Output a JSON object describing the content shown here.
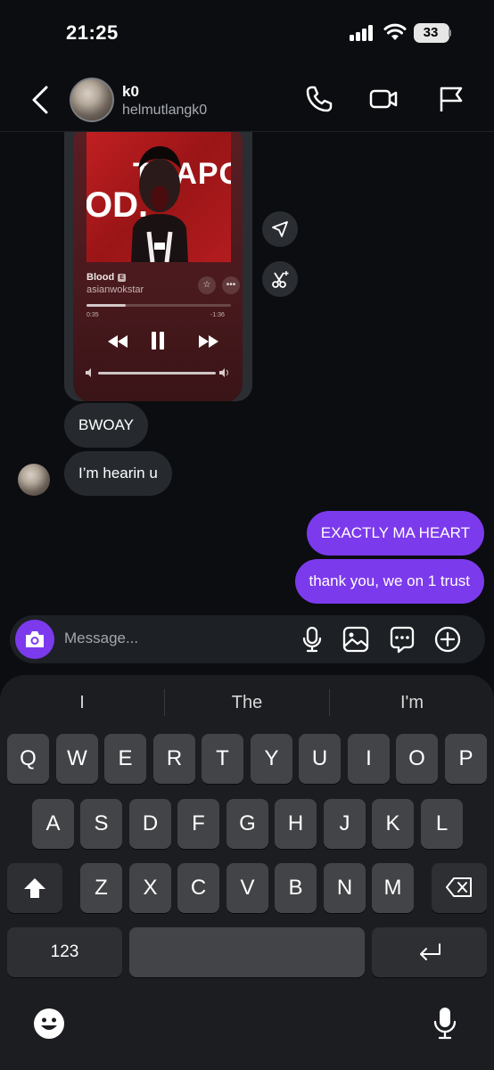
{
  "status_bar": {
    "time": "21:25",
    "battery": "33"
  },
  "header": {
    "name": "k0",
    "handle": "helmutlangk0"
  },
  "music_card": {
    "cover_text_top": "TRAPG",
    "cover_text_left": "OD.",
    "song_title": "Blood",
    "explicit_badge": "E",
    "artist": "asianwokstar",
    "time_elapsed": "0:35",
    "time_remaining": "-1:36",
    "progress_fraction": 0.27
  },
  "messages": [
    {
      "from": "them",
      "text": "BWOAY"
    },
    {
      "from": "them",
      "text": "I’m hearin u"
    },
    {
      "from": "me",
      "text": "EXACTLY MA HEART"
    },
    {
      "from": "me",
      "text": "thank you, we on 1 trust"
    }
  ],
  "composer": {
    "placeholder": "Message..."
  },
  "keyboard": {
    "suggestions": [
      "I",
      "The",
      "I'm"
    ],
    "row1": [
      "Q",
      "W",
      "E",
      "R",
      "T",
      "Y",
      "U",
      "I",
      "O",
      "P"
    ],
    "row2": [
      "A",
      "S",
      "D",
      "F",
      "G",
      "H",
      "J",
      "K",
      "L"
    ],
    "row3": [
      "Z",
      "X",
      "C",
      "V",
      "B",
      "N",
      "M"
    ],
    "numbers_key": "123"
  },
  "colors": {
    "accent": "#7c3aed",
    "background": "#0b0d10",
    "incoming_bubble": "#262a2f"
  }
}
